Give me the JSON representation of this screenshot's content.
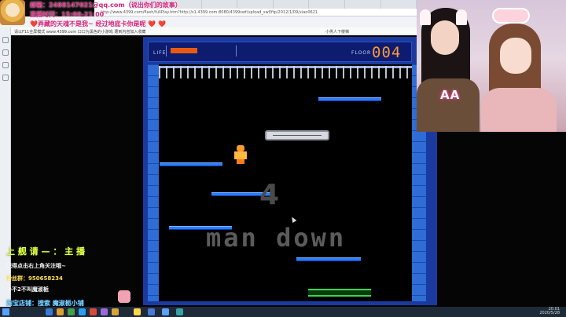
{
  "overlay": {
    "line1": "邮箱：2488147021@qq.com（说出你们的故事）",
    "line2": "直播时间：15:00-21:00",
    "line3": "❤️弄藏的天魂不是我~ 经过地底卡你是呢 ❤️ ❤️"
  },
  "browser": {
    "tabs": [
      "",
      "",
      "",
      "",
      "",
      "",
      "",
      "",
      ""
    ],
    "address": "http://www.4399.com/flash/fullPlay.htm?http://s1.4399.com:8080/4399swf/upload_swf/ftp/2012/1/09/xiao0621",
    "subbar_text": "请以F11全屏模式 www.4399.com 口口为黑色的小游戏 遭到内容加入收藏",
    "game_title": "小男人下楼梯"
  },
  "game": {
    "life_label": "LIFE",
    "floor_label": "FLOOR",
    "floor_number": "004",
    "life_level": 0.4,
    "big_number": "4",
    "title_text": "man down"
  },
  "webcam": {
    "tag": "AA"
  },
  "bottom_overlay": {
    "line1": "上 舰 请 — ： 主 播",
    "line2": "记得点击右上角关注哦~",
    "line3": "粉丝群：950658234",
    "line4": "@不2不叫魔淑栀",
    "line5": "淘宝店铺：搜索 魔淑栀小铺"
  },
  "taskbar": {
    "time": "20:01",
    "date": "2020/5/28"
  }
}
